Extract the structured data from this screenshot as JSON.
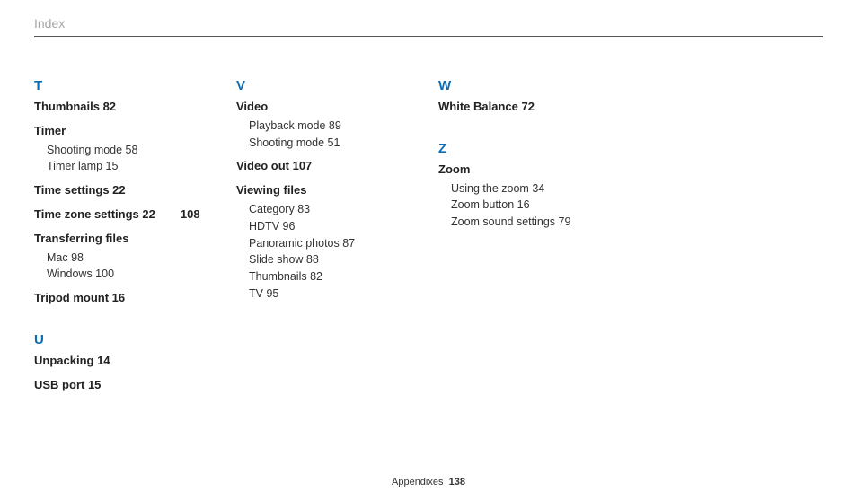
{
  "header": {
    "title": "Index"
  },
  "footer": {
    "label": "Appendixes",
    "page": "138"
  },
  "col1": {
    "sections": [
      {
        "letter": "T",
        "entries": [
          {
            "term": "Thumbnails",
            "page": "82"
          },
          {
            "term": "Timer",
            "subs": [
              {
                "label": "Shooting mode",
                "page": "58"
              },
              {
                "label": "Timer lamp",
                "page": "15"
              }
            ]
          },
          {
            "term": "Time settings",
            "page": "22"
          },
          {
            "term": "Time zone settings",
            "page": "22",
            "extraPage": "108"
          },
          {
            "term": "Transferring files",
            "subs": [
              {
                "label": "Mac",
                "page": "98"
              },
              {
                "label": "Windows",
                "page": "100"
              }
            ]
          },
          {
            "term": "Tripod mount",
            "page": "16"
          }
        ]
      },
      {
        "letter": "U",
        "entries": [
          {
            "term": "Unpacking",
            "page": "14"
          },
          {
            "term": "USB port",
            "page": "15"
          }
        ]
      }
    ]
  },
  "col2": {
    "sections": [
      {
        "letter": "V",
        "entries": [
          {
            "term": "Video",
            "subs": [
              {
                "label": "Playback mode",
                "page": "89"
              },
              {
                "label": "Shooting mode",
                "page": "51"
              }
            ]
          },
          {
            "term": "Video out",
            "page": "107"
          },
          {
            "term": "Viewing files",
            "subs": [
              {
                "label": "Category",
                "page": "83"
              },
              {
                "label": "HDTV",
                "page": "96"
              },
              {
                "label": "Panoramic photos",
                "page": "87"
              },
              {
                "label": "Slide show",
                "page": "88"
              },
              {
                "label": "Thumbnails",
                "page": "82"
              },
              {
                "label": "TV",
                "page": "95"
              }
            ]
          }
        ]
      }
    ]
  },
  "col3": {
    "sections": [
      {
        "letter": "W",
        "entries": [
          {
            "term": "White Balance",
            "page": "72"
          }
        ]
      },
      {
        "letter": "Z",
        "entries": [
          {
            "term": "Zoom",
            "subs": [
              {
                "label": "Using the zoom",
                "page": "34"
              },
              {
                "label": "Zoom button",
                "page": "16"
              },
              {
                "label": "Zoom sound settings",
                "page": "79"
              }
            ]
          }
        ]
      }
    ]
  }
}
